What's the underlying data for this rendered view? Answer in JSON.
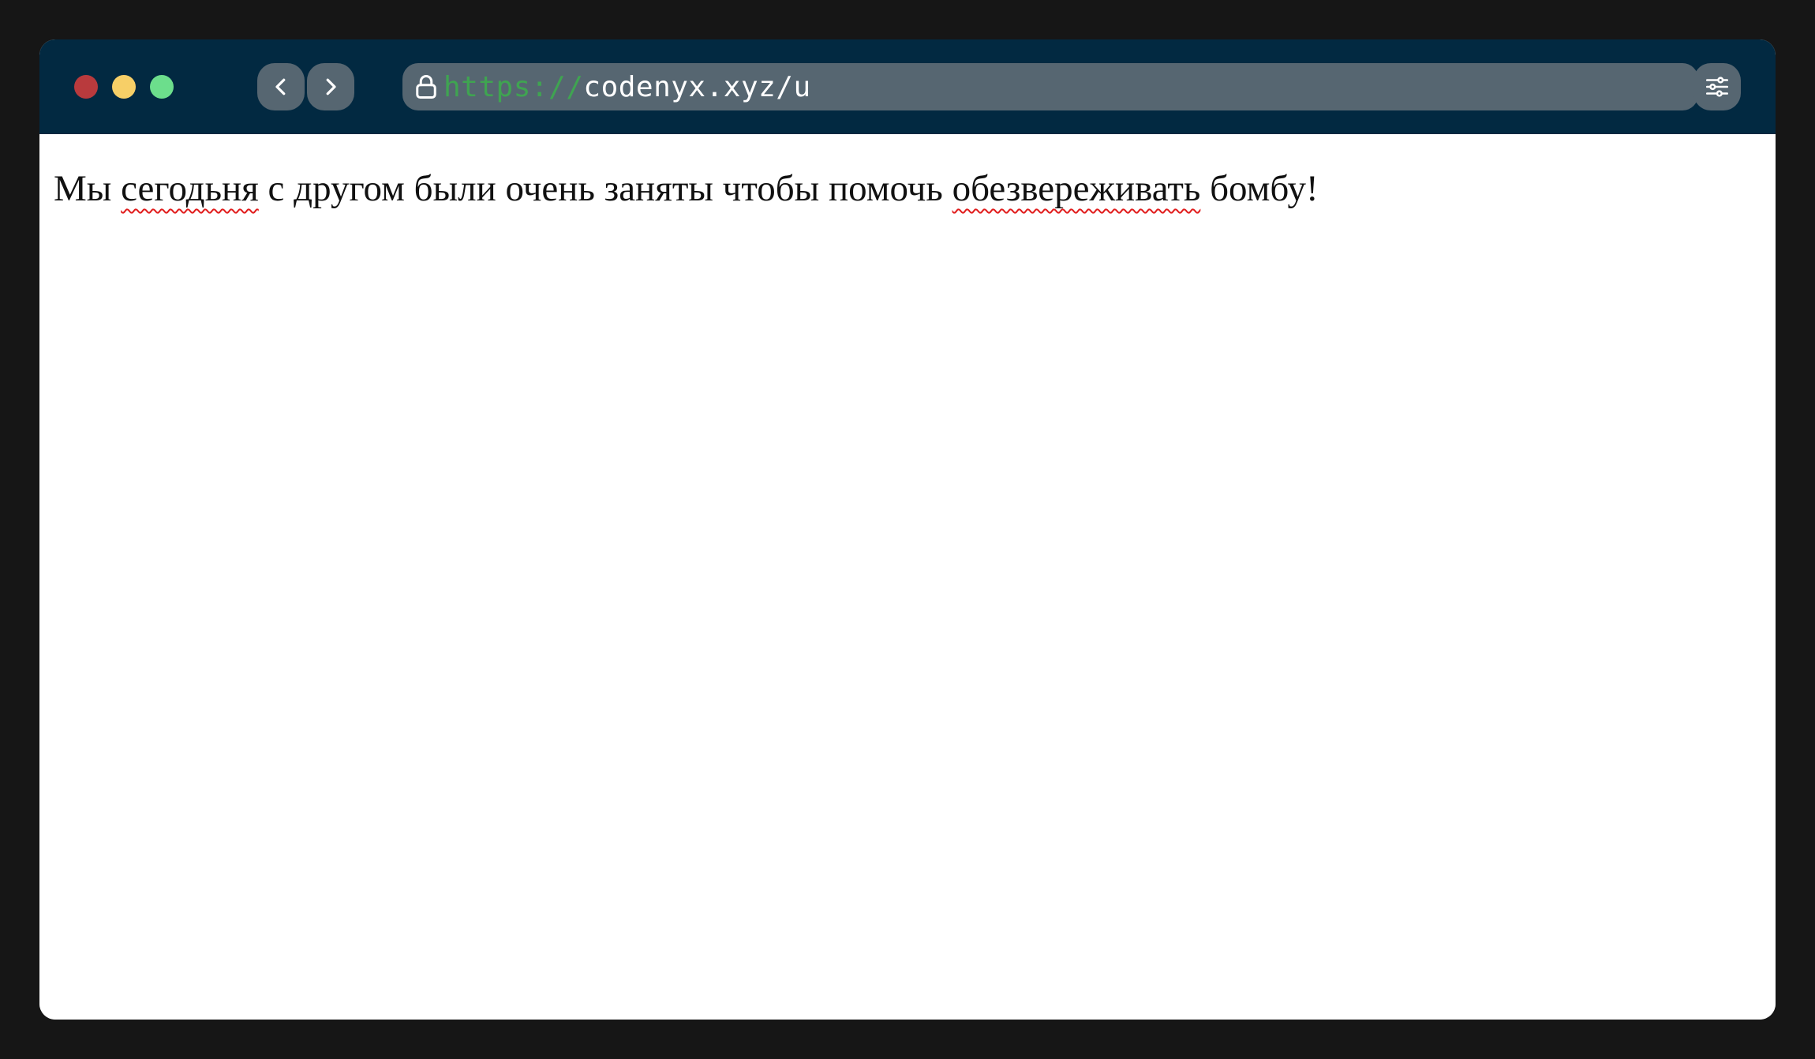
{
  "browser": {
    "url_scheme": "https://",
    "url_host": "codenyx.xyz/u",
    "icons": {
      "back": "chevron-left-icon",
      "forward": "chevron-right-icon",
      "lock": "lock-icon",
      "settings": "sliders-icon"
    },
    "colors": {
      "titlebar": "#022941",
      "control": "#566671",
      "close": "#b93a3d",
      "minimize": "#f7cf67",
      "maximize": "#6cde8c",
      "scheme": "#3fa451",
      "spellcheck": "#e11d1d"
    }
  },
  "page": {
    "sentence": {
      "w1": "Мы",
      "w2": "сегодьня",
      "w3": "с другом были очень заняты чтобы помочь",
      "w4": "обезвереживать",
      "w5": "бомбу!"
    }
  }
}
